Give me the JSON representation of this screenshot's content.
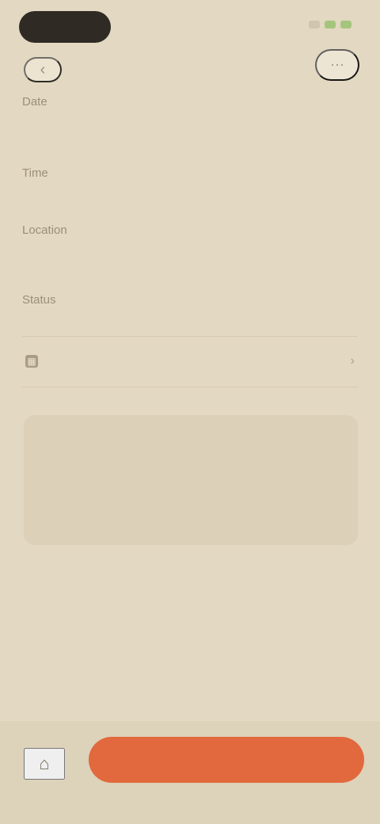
{
  "header": {
    "back_icon": "‹",
    "action_icon": "⋯"
  },
  "details": [
    {
      "label": "Date",
      "value": ""
    },
    {
      "label": "Time",
      "value": ""
    },
    {
      "label": "Location",
      "value": ""
    },
    {
      "label": "Status",
      "value": ""
    }
  ],
  "section": {
    "title": "",
    "icon": "▦",
    "chevron": "›"
  },
  "card": {
    "title": "",
    "col_left": "",
    "col_right": ""
  },
  "footer": {
    "link_text": ""
  },
  "bottom": {
    "icon": "⌂",
    "primary_label": ""
  },
  "colors": {
    "background": "#e3d8c1",
    "accent": "#e2683d",
    "card": "#dcd0b9"
  }
}
